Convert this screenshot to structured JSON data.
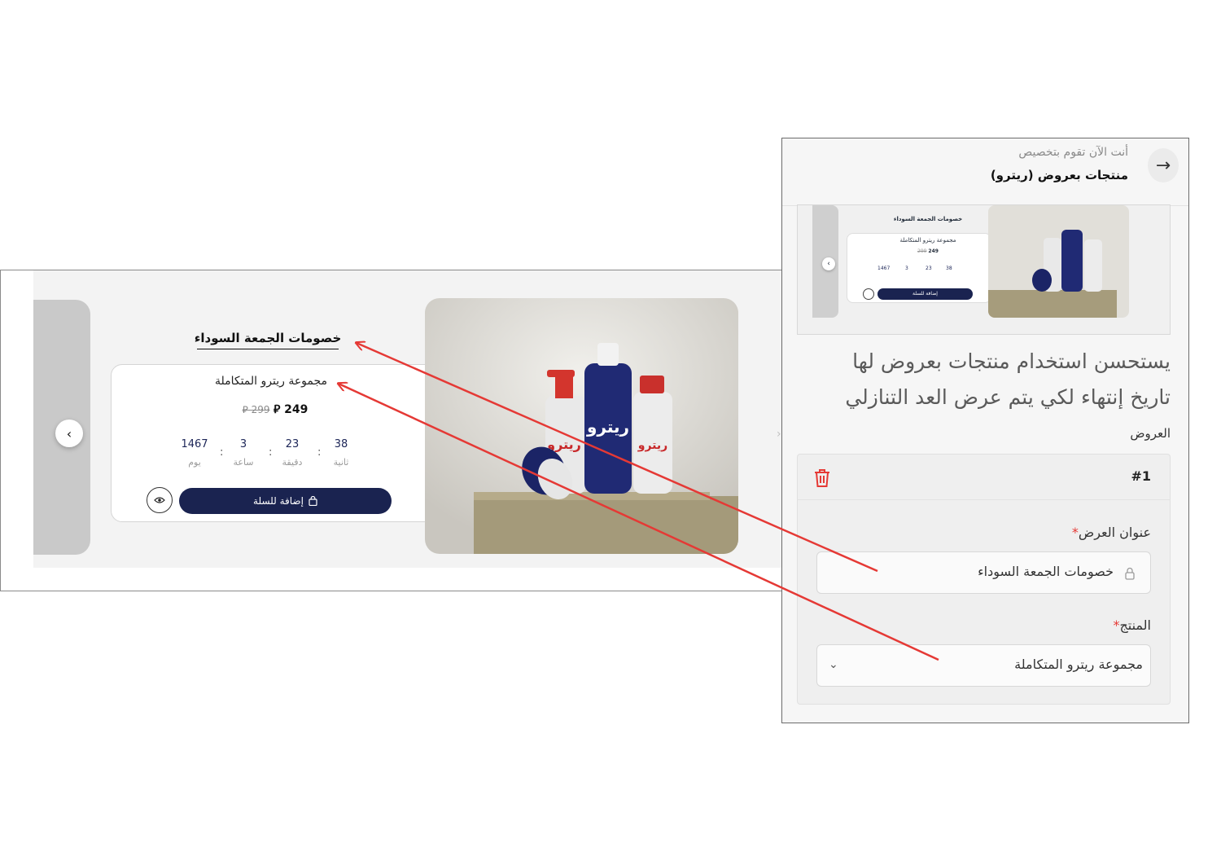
{
  "preview": {
    "offer_title": "خصومات الجمعة السوداء",
    "product_name": "مجموعة ريترو المتكاملة",
    "price_new": "249",
    "price_old": "299",
    "currency": "⃁",
    "countdown": {
      "days": "1467",
      "hours": "3",
      "minutes": "23",
      "seconds": "38",
      "days_label": "يوم",
      "hours_label": "ساعة",
      "minutes_label": "دقيقة",
      "seconds_label": "ثانية"
    },
    "add_to_cart": "إضافة للسلة"
  },
  "thumb": {
    "offer_title": "خصومات الجمعة السوداء",
    "product_name": "مجموعة ريترو المتكاملة",
    "price_new": "249",
    "price_old": "299",
    "days": "1467",
    "hours": "3",
    "minutes": "23",
    "seconds": "38",
    "add_to_cart": "إضافة للسلة"
  },
  "panel": {
    "header_subtitle": "أنت الآن تقوم بتخصيص",
    "header_title": "منتجات بعروض (ريترو)",
    "hint": "يستحسن استخدام منتجات بعروض لها تاريخ إنتهاء لكي يتم عرض العد التنازلي",
    "offers_label": "العروض",
    "offer_number": "#1",
    "title_label": "عنوان العرض",
    "title_value": "خصومات الجمعة السوداء",
    "product_label": "المنتج",
    "product_value": "مجموعة ريترو المتكاملة",
    "required_mark": "*"
  },
  "colors": {
    "navy": "#1a2350",
    "annotation_red": "#e53935"
  }
}
